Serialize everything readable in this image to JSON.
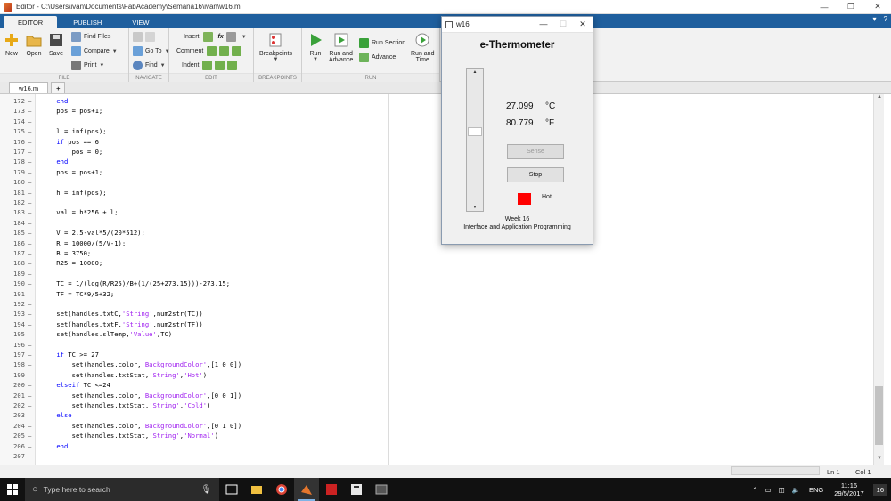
{
  "window": {
    "title": "Editor - C:\\Users\\ivan\\Documents\\FabAcademy\\Semana16\\ivan\\w16.m"
  },
  "ribbon": {
    "tabs": [
      "EDITOR",
      "PUBLISH",
      "VIEW"
    ],
    "file": {
      "label": "FILE",
      "new": "New",
      "open": "Open",
      "save": "Save",
      "find_files": "Find Files",
      "compare": "Compare",
      "print": "Print"
    },
    "navigate": {
      "label": "NAVIGATE",
      "go_to": "Go To",
      "find": "Find"
    },
    "edit": {
      "label": "EDIT",
      "insert": "Insert",
      "comment": "Comment",
      "indent": "Indent",
      "fx": "fx"
    },
    "breakpoints": {
      "label": "BREAKPOINTS",
      "breakpoints": "Breakpoints"
    },
    "run": {
      "label": "RUN",
      "run": "Run",
      "run_and_advance_1": "Run and",
      "run_and_advance_2": "Advance",
      "run_section": "Run Section",
      "advance": "Advance",
      "run_and_time_1": "Run and",
      "run_and_time_2": "Time"
    }
  },
  "file_tabs": {
    "active": "w16.m",
    "add": "+"
  },
  "code_lines": [
    {
      "n": "172",
      "html": "    <span class='kw'>end</span>"
    },
    {
      "n": "173",
      "html": "    pos = pos+1;"
    },
    {
      "n": "174",
      "html": ""
    },
    {
      "n": "175",
      "html": "    l = inf(pos);"
    },
    {
      "n": "176",
      "html": "    <span class='kw'>if</span> pos == 6"
    },
    {
      "n": "177",
      "html": "        pos = 0;"
    },
    {
      "n": "178",
      "html": "    <span class='kw'>end</span>"
    },
    {
      "n": "179",
      "html": "    pos = pos+1;"
    },
    {
      "n": "180",
      "html": ""
    },
    {
      "n": "181",
      "html": "    h = inf(pos);"
    },
    {
      "n": "182",
      "html": ""
    },
    {
      "n": "183",
      "html": "    val = h*256 + l;"
    },
    {
      "n": "184",
      "html": ""
    },
    {
      "n": "185",
      "html": "    V = 2.5-val*5/(20*512);"
    },
    {
      "n": "186",
      "html": "    R = 10000/(5/V-1);"
    },
    {
      "n": "187",
      "html": "    B = 3750;"
    },
    {
      "n": "188",
      "html": "    R25 = 10000;"
    },
    {
      "n": "189",
      "html": ""
    },
    {
      "n": "190",
      "html": "    TC = 1/(log(R/R25)/B+(1/(25+273.15)))-273.15;"
    },
    {
      "n": "191",
      "html": "    TF = TC*9/5+32;"
    },
    {
      "n": "192",
      "html": ""
    },
    {
      "n": "193",
      "html": "    set(handles.txtC,<span class='str'>'String'</span>,num2str(TC))"
    },
    {
      "n": "194",
      "html": "    set(handles.txtF,<span class='str'>'String'</span>,num2str(TF))"
    },
    {
      "n": "195",
      "html": "    set(handles.slTemp,<span class='str'>'Value'</span>,TC)"
    },
    {
      "n": "196",
      "html": ""
    },
    {
      "n": "197",
      "html": "    <span class='kw'>if</span> TC >= 27"
    },
    {
      "n": "198",
      "html": "        set(handles.color,<span class='str'>'BackgroundColor'</span>,[1 0 0])"
    },
    {
      "n": "199",
      "html": "        set(handles.txtStat,<span class='str'>'String'</span>,<span class='str'>'Hot'</span>)"
    },
    {
      "n": "200",
      "html": "    <span class='kw'>elseif</span> TC <=24"
    },
    {
      "n": "201",
      "html": "        set(handles.color,<span class='str'>'BackgroundColor'</span>,[0 0 1])"
    },
    {
      "n": "202",
      "html": "        set(handles.txtStat,<span class='str'>'String'</span>,<span class='str'>'Cold'</span>)"
    },
    {
      "n": "203",
      "html": "    <span class='kw'>else</span>"
    },
    {
      "n": "204",
      "html": "        set(handles.color,<span class='str'>'BackgroundColor'</span>,[0 1 0])"
    },
    {
      "n": "205",
      "html": "        set(handles.txtStat,<span class='str'>'String'</span>,<span class='str'>'Normal'</span>)"
    },
    {
      "n": "206",
      "html": "    <span class='kw'>end</span>"
    },
    {
      "n": "207",
      "html": ""
    }
  ],
  "status": {
    "ln": "Ln  1",
    "col": "Col  1"
  },
  "figure": {
    "title": "w16",
    "heading": "e-Thermometer",
    "temp_c": "27.099",
    "unit_c": "°C",
    "temp_f": "80.779",
    "unit_f": "°F",
    "sense_label": "Sense",
    "stop_label": "Stop",
    "status_text": "Hot",
    "status_color": "#ff0000",
    "footer_1": "Week 16",
    "footer_2": "Interface and Application Programming"
  },
  "taskbar": {
    "search_placeholder": "Type here to search",
    "lang": "ENG",
    "time": "11:16",
    "date": "29/5/2017",
    "notif": "16"
  }
}
